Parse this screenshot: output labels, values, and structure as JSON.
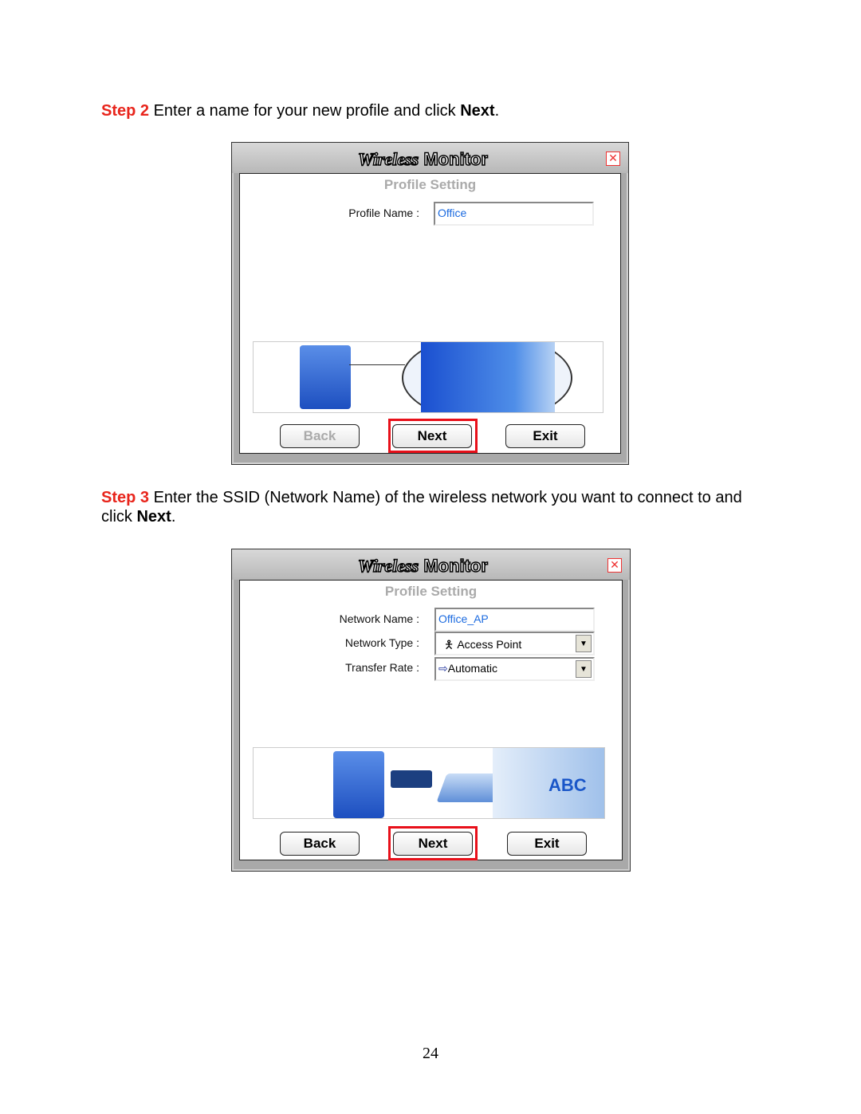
{
  "step2": {
    "label": "Step 2",
    "text": " Enter a name for your new profile and click ",
    "bold": "Next",
    "end": "."
  },
  "step3": {
    "label": "Step 3",
    "text": " Enter the SSID (Network Name) of the wireless network you want to connect to and click ",
    "bold": "Next",
    "end": "."
  },
  "dialog1": {
    "logo_a": "Wireless",
    "logo_b": "Monitor",
    "section": "Profile Setting",
    "profile_name_label": "Profile Name :",
    "profile_name_value": "Office",
    "back": "Back",
    "next": "Next",
    "exit": "Exit",
    "back_disabled": true
  },
  "dialog2": {
    "logo_a": "Wireless",
    "logo_b": "Monitor",
    "section": "Profile Setting",
    "network_name_label": "Network Name :",
    "network_name_value": "Office_AP",
    "network_type_label": "Network Type :",
    "network_type_value": "Access Point",
    "transfer_rate_label": "Transfer Rate :",
    "transfer_rate_value": "Automatic",
    "strip_text": "ABC",
    "back": "Back",
    "next": "Next",
    "exit": "Exit"
  },
  "colors": {
    "step_label": "#e8251c",
    "highlight": "#e8101a",
    "field_value": "#1c6be0"
  },
  "page_number": "24"
}
